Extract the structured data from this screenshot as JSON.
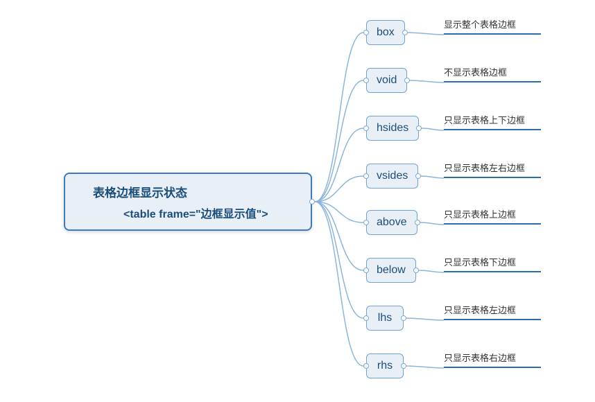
{
  "root": {
    "line1": "表格边框显示状态",
    "line2": "<table frame=\"边框显示值\">"
  },
  "children": [
    {
      "value": "box",
      "desc": "显示整个表格边框"
    },
    {
      "value": "void",
      "desc": "不显示表格边框"
    },
    {
      "value": "hsides",
      "desc": "只显示表格上下边框"
    },
    {
      "value": "vsides",
      "desc": "只显示表格左右边框"
    },
    {
      "value": "above",
      "desc": "只显示表格上边框"
    },
    {
      "value": "below",
      "desc": "只显示表格下边框"
    },
    {
      "value": "lhs",
      "desc": "只显示表格左边框"
    },
    {
      "value": "rhs",
      "desc": "只显示表格右边框"
    }
  ],
  "layout": {
    "rootRight": 450,
    "rootMidY": 291,
    "childX": 528,
    "descX": 640,
    "childYs": [
      29,
      98,
      167,
      236,
      303,
      372,
      441,
      510
    ],
    "childH": 36
  }
}
